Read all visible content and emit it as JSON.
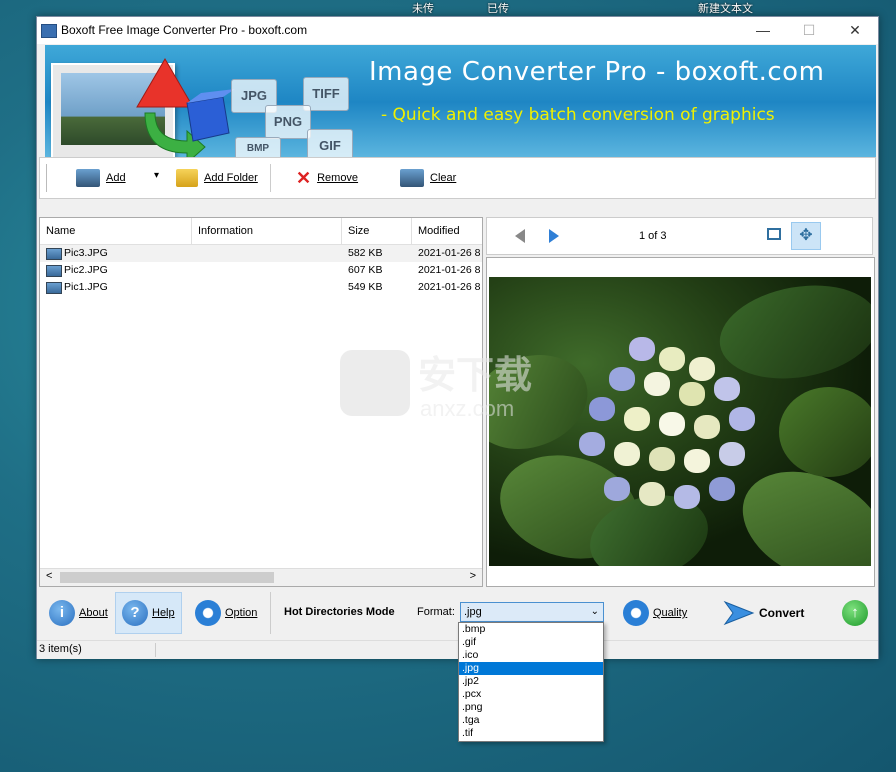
{
  "desktop": {
    "labels": [
      "未传",
      "已传",
      "新建文本文"
    ]
  },
  "window": {
    "title": "Boxoft Free Image Converter Pro - boxoft.com",
    "controls": {
      "minimize": "—",
      "maximize": "☐",
      "close": "✕"
    }
  },
  "banner": {
    "title": "Image Converter Pro - boxoft.com",
    "subtitle": "- Quick and easy batch conversion of graphics",
    "formats": [
      "JPG",
      "TIFF",
      "PNG",
      "BMP",
      "GIF"
    ]
  },
  "toolbar": {
    "add": "Add",
    "add_dropdown": "▾",
    "add_folder": "Add Folder",
    "remove": "Remove",
    "clear": "Clear"
  },
  "file_list": {
    "columns": [
      "Name",
      "Information",
      "Size",
      "Modified"
    ],
    "rows": [
      {
        "name": "Pic3.JPG",
        "info": "",
        "size": "582 KB",
        "modified": "2021-01-26 8"
      },
      {
        "name": "Pic2.JPG",
        "info": "",
        "size": "607 KB",
        "modified": "2021-01-26 8"
      },
      {
        "name": "Pic1.JPG",
        "info": "",
        "size": "549 KB",
        "modified": "2021-01-26 8"
      }
    ],
    "scroll_left": "<",
    "scroll_right": ">"
  },
  "preview": {
    "page_indicator": "1 of 3"
  },
  "bottom": {
    "about": "About",
    "help": "Help",
    "option": "Option",
    "hot_dirs": "Hot Directories Mode",
    "format_label": "Format:",
    "format_value": ".jpg",
    "quality": "Quality",
    "convert": "Convert",
    "format_options": [
      ".bmp",
      ".gif",
      ".ico",
      ".jpg",
      ".jp2",
      ".pcx",
      ".png",
      ".tga",
      ".tif"
    ]
  },
  "status": {
    "items": "3 item(s)"
  },
  "watermark": {
    "text_cn": "安下载",
    "text_en": "anxz.com"
  },
  "colors": {
    "accent": "#0078d7",
    "banner": "#1e86c4",
    "subtitle": "#f0f000"
  }
}
